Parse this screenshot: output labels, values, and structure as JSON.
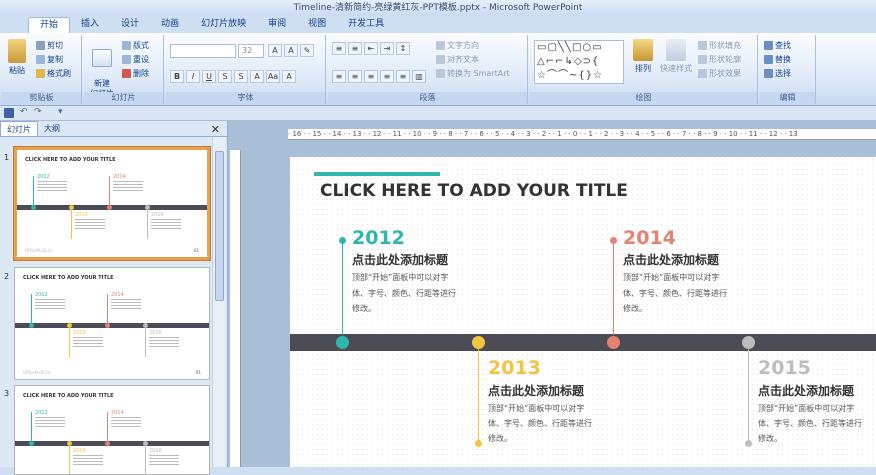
{
  "window": {
    "title": "Timeline-清新简约-亮绿黄红灰-PPT模板.pptx - Microsoft PowerPoint"
  },
  "tabs": [
    "开始",
    "插入",
    "设计",
    "动画",
    "幻灯片放映",
    "审阅",
    "视图",
    "开发工具"
  ],
  "ribbon": {
    "clipboard": {
      "label": "剪贴板",
      "paste": "粘贴",
      "cut": "剪切",
      "copy": "复制",
      "format_painter": "格式刷"
    },
    "slides": {
      "label": "幻灯片",
      "new_slide": "新建\n幻灯片",
      "layout": "版式",
      "reset": "重设",
      "delete": "删除"
    },
    "font": {
      "label": "字体",
      "size": "32"
    },
    "paragraph": {
      "label": "段落",
      "text_direction": "文字方向",
      "align_text": "对齐文本",
      "smartart": "转换为 SmartArt"
    },
    "drawing": {
      "label": "绘图",
      "arrange": "排列",
      "quick_styles": "快速样式",
      "shape_fill": "形状填充",
      "shape_outline": "形状轮廓",
      "shape_effects": "形状效果"
    },
    "editing": {
      "label": "编辑",
      "find": "查找",
      "replace": "替换",
      "select": "选择"
    }
  },
  "panel": {
    "tab_slides": "幻灯片",
    "tab_outline": "大纲",
    "slide_numbers": [
      "1",
      "2",
      "3"
    ]
  },
  "ruler": {
    "top": "· 16 · · 15 · · 14 · · 13 · · 12 · · 11 · · 10 · · 9 · · 8 · · 7 · · 6 · · 5 · · 4 · · 3 · · 2 · · 1 · · 0 · · 1 · · 2 · · 3 · · 4 · · 5 · · 6 · · 7 · · 8 · · 9 · · 10 · · 11 · · 12 · · 13"
  },
  "slide": {
    "title": "CLICK HERE TO ADD YOUR TITLE",
    "heading": "点击此处添加标题",
    "body_1": "顶部“开始”面板中可以对字",
    "body_2": "体、字号、颜色、行距等进行",
    "body_3": "修改。",
    "items": [
      {
        "year": "2012",
        "color": "#2fb7ad"
      },
      {
        "year": "2013",
        "color": "#f4c340"
      },
      {
        "year": "2014",
        "color": "#e48171"
      },
      {
        "year": "2015",
        "color": "#bdbdbd"
      }
    ]
  },
  "thumb": {
    "title": "CLICK HERE TO ADD YOUR TITLE",
    "years": [
      "2012",
      "2014",
      "2013",
      "2016"
    ],
    "footer": "OfficePLUS.cn",
    "page": "01"
  }
}
